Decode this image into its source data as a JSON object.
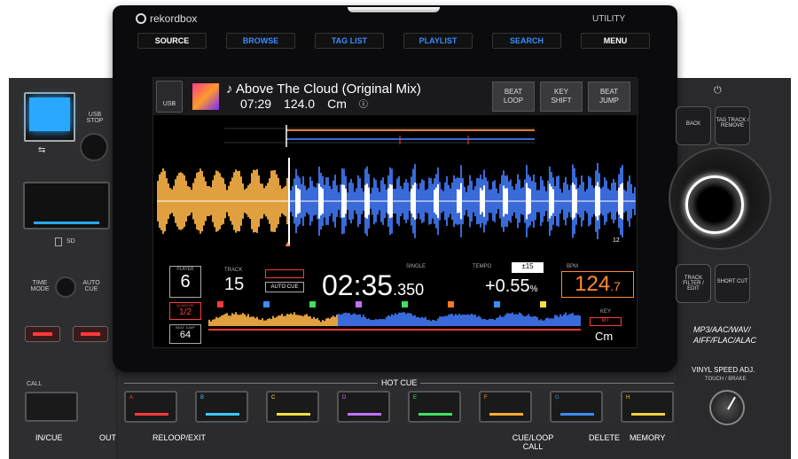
{
  "brand": "rekordbox",
  "utility": "UTILITY",
  "nav": [
    "SOURCE",
    "BROWSE",
    "TAG LIST",
    "PLAYLIST",
    "SEARCH",
    "MENU"
  ],
  "track": {
    "title": "Above The Cloud (Original Mix)",
    "time": "07:29",
    "bpm": "124.0",
    "key": "Cm",
    "device": "USB"
  },
  "header_buttons": [
    {
      "l1": "BEAT",
      "l2": "LOOP"
    },
    {
      "l1": "KEY",
      "l2": "SHIFT"
    },
    {
      "l1": "BEAT",
      "l2": "JUMP"
    }
  ],
  "zoom": "12",
  "info": {
    "player_label": "PLAYER",
    "player": "6",
    "track_label": "TRACK",
    "track_num": "15",
    "auto_cue": "AUTO CUE",
    "single_label": "SINGLE",
    "elapsed": "02:35",
    "elapsed_ms": ".350",
    "tempo_label": "TEMPO",
    "tempo_range": "±15",
    "tempo": "+0.55",
    "tempo_unit": "%",
    "bpm_label": "BPM",
    "bpm_big": "124",
    "bpm_dec": ".7",
    "quantize_label": "QUANTIZE",
    "quantize": "1/2",
    "beat_jump_label": "BEAT JUMP",
    "beat_jump": "64",
    "mt": "MT",
    "key_label": "KEY",
    "key": "Cm"
  },
  "hot_cue_label": "HOT CUE",
  "pads": [
    {
      "l": "A",
      "c": "#ff3a3a"
    },
    {
      "l": "B",
      "c": "#3ac8ff"
    },
    {
      "l": "C",
      "c": "#f0e040"
    },
    {
      "l": "D",
      "c": "#c070ff"
    },
    {
      "l": "E",
      "c": "#40e060"
    },
    {
      "l": "F",
      "c": "#ffaa30"
    },
    {
      "l": "G",
      "c": "#3a8cff"
    },
    {
      "l": "H",
      "c": "#f0d040"
    }
  ],
  "cue_colors": [
    "#ff3a3a",
    "#3a8cff",
    "#40e060",
    "#c070ff",
    "#40e060",
    "#ff7a20",
    "#3a8cff",
    "#f0e040"
  ],
  "bottom": [
    "IN/CUE",
    "OUT",
    "RELOOP/EXIT",
    "CUE/LOOP CALL",
    "DELETE",
    "MEMORY"
  ],
  "left": {
    "usb_stop": "USB STOP",
    "sd": "SD",
    "time_mode": "TIME MODE",
    "auto_cue": "AUTO CUE",
    "call": "CALL"
  },
  "right": {
    "back": "BACK",
    "tag_track": "TAG TRACK / REMOVE",
    "track_filter": "TRACK FILTER / EDIT",
    "short_cut": "SHORT CUT",
    "formats": "MP3/AAC/WAV/ AIFF/FLAC/ALAC",
    "vinyl": "VINYL SPEED ADJ.",
    "touch_brake": "TOUCH / BRAKE"
  },
  "colors": {
    "wave_blue": "#3a6ad8",
    "wave_orange": "#e0a040",
    "bpm": "#ff8a30",
    "accent": "#3a8cff"
  }
}
